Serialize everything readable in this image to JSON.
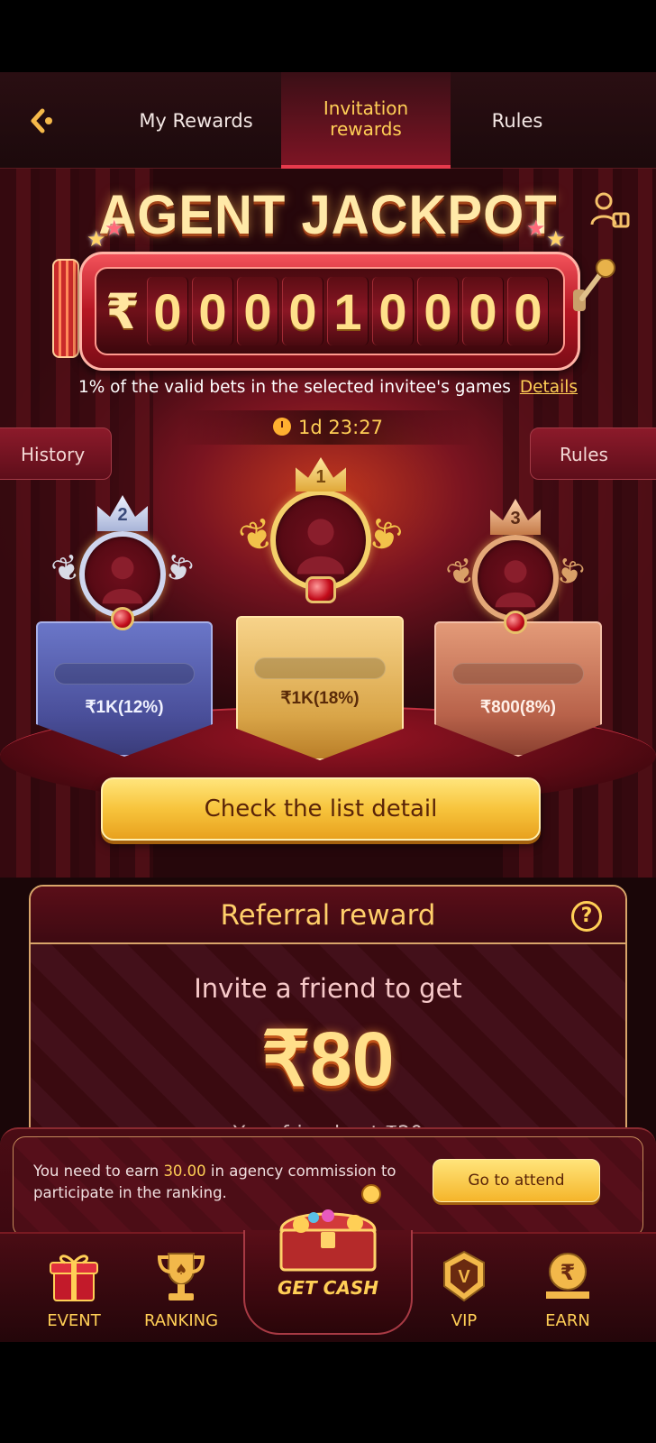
{
  "header": {
    "back_icon": "back-arrow-icon",
    "tabs": [
      {
        "label": "My Rewards",
        "active": false
      },
      {
        "label": "Invitation rewards",
        "active": true
      },
      {
        "label": "Rules",
        "active": false
      }
    ]
  },
  "jackpot": {
    "title": "AGENT JACKPOT",
    "currency": "₹",
    "digits": [
      "0",
      "0",
      "0",
      "0",
      "1",
      "0",
      "0",
      "0",
      "0"
    ],
    "description": "1% of the valid bets in the selected invitee's games",
    "details_link": "Details",
    "timer": "1d 23:27",
    "history_label": "History",
    "rules_label": "Rules"
  },
  "podium": [
    {
      "rank": "2",
      "amount": "₹1K(12%)"
    },
    {
      "rank": "1",
      "amount": "₹1K(18%)"
    },
    {
      "rank": "3",
      "amount": "₹800(8%)"
    }
  ],
  "check_button": "Check the list detail",
  "referral": {
    "title": "Referral reward",
    "invite_text": "Invite a friend to get",
    "amount": "₹80",
    "friend_text": "Your friend get ₹20"
  },
  "notice": {
    "text_before": "You need to earn ",
    "highlight": "30.00",
    "text_after": " in agency commission to participate in the ranking.",
    "button": "Go to attend"
  },
  "nav": {
    "event": "EVENT",
    "ranking": "RANKING",
    "getcash": "GET CASH",
    "vip": "VIP",
    "earn": "EARN"
  },
  "colors": {
    "accent_gold": "#ffcf56",
    "bg_dark_red": "#26070b",
    "button_yellow": "#f7c43c"
  }
}
